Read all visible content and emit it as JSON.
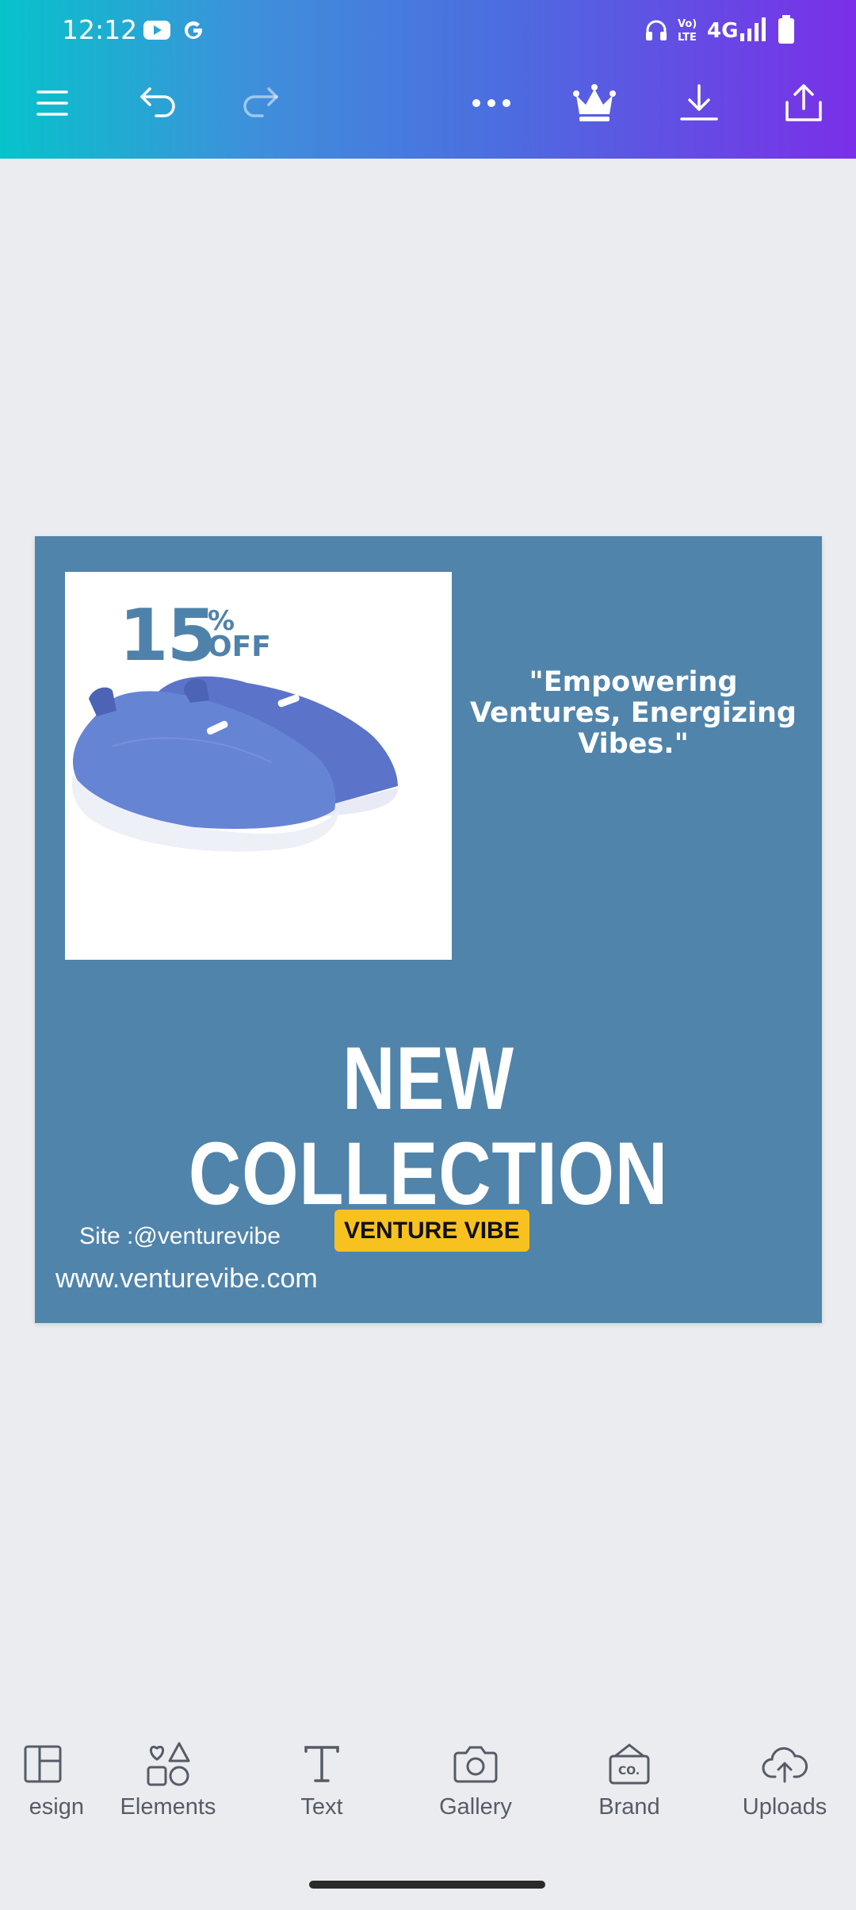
{
  "status_bar": {
    "time": "12:12",
    "network": "4G",
    "icons": [
      "youtube-icon",
      "google-icon",
      "headphones-icon",
      "volte-icon",
      "signal-icon",
      "battery-icon"
    ]
  },
  "toolbar": {
    "buttons": [
      "menu-icon",
      "undo-icon",
      "redo-icon",
      "more-icon",
      "crown-icon",
      "download-icon",
      "share-icon"
    ]
  },
  "design": {
    "background_color": "#5084ab",
    "discount": {
      "number": "15",
      "percent": "%",
      "off": "OFF"
    },
    "quote": "\"Empowering Ventures, Energizing Vibes.\"",
    "headline": "NEW COLLECTION",
    "site": "Site :@venturevibe",
    "brand_badge": "VENTURE VIBE",
    "url": "www.venturevibe.com",
    "badge_color": "#f7c21f"
  },
  "bottom_nav": {
    "items": [
      {
        "label": "esign",
        "icon": "design-icon"
      },
      {
        "label": "Elements",
        "icon": "elements-icon"
      },
      {
        "label": "Text",
        "icon": "text-icon"
      },
      {
        "label": "Gallery",
        "icon": "camera-icon"
      },
      {
        "label": "Brand",
        "icon": "brand-icon"
      },
      {
        "label": "Uploads",
        "icon": "upload-icon"
      }
    ]
  }
}
